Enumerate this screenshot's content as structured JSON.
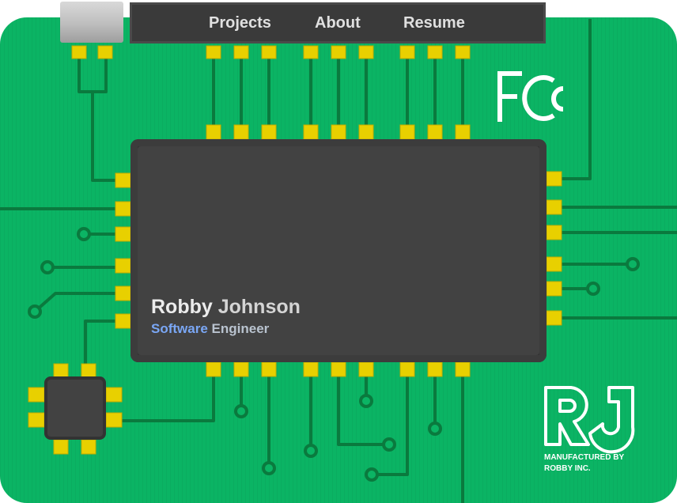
{
  "nav": {
    "projects": "Projects",
    "about": "About",
    "resume": "Resume"
  },
  "hero": {
    "first_name": "Robby",
    "last_name": "Johnson",
    "title_first": "Software",
    "title_second": "Engineer"
  },
  "logo": {
    "monogram": "RJ",
    "manufacturer_line1": "MANUFACTURED BY",
    "manufacturer_line2": "ROBBY INC."
  },
  "fcc_mark": "FC",
  "colors": {
    "board": "#0bb464",
    "trace": "#0a7a3e",
    "pin": "#e8d000",
    "chip": "#424242",
    "accent": "#7aa7f5"
  }
}
